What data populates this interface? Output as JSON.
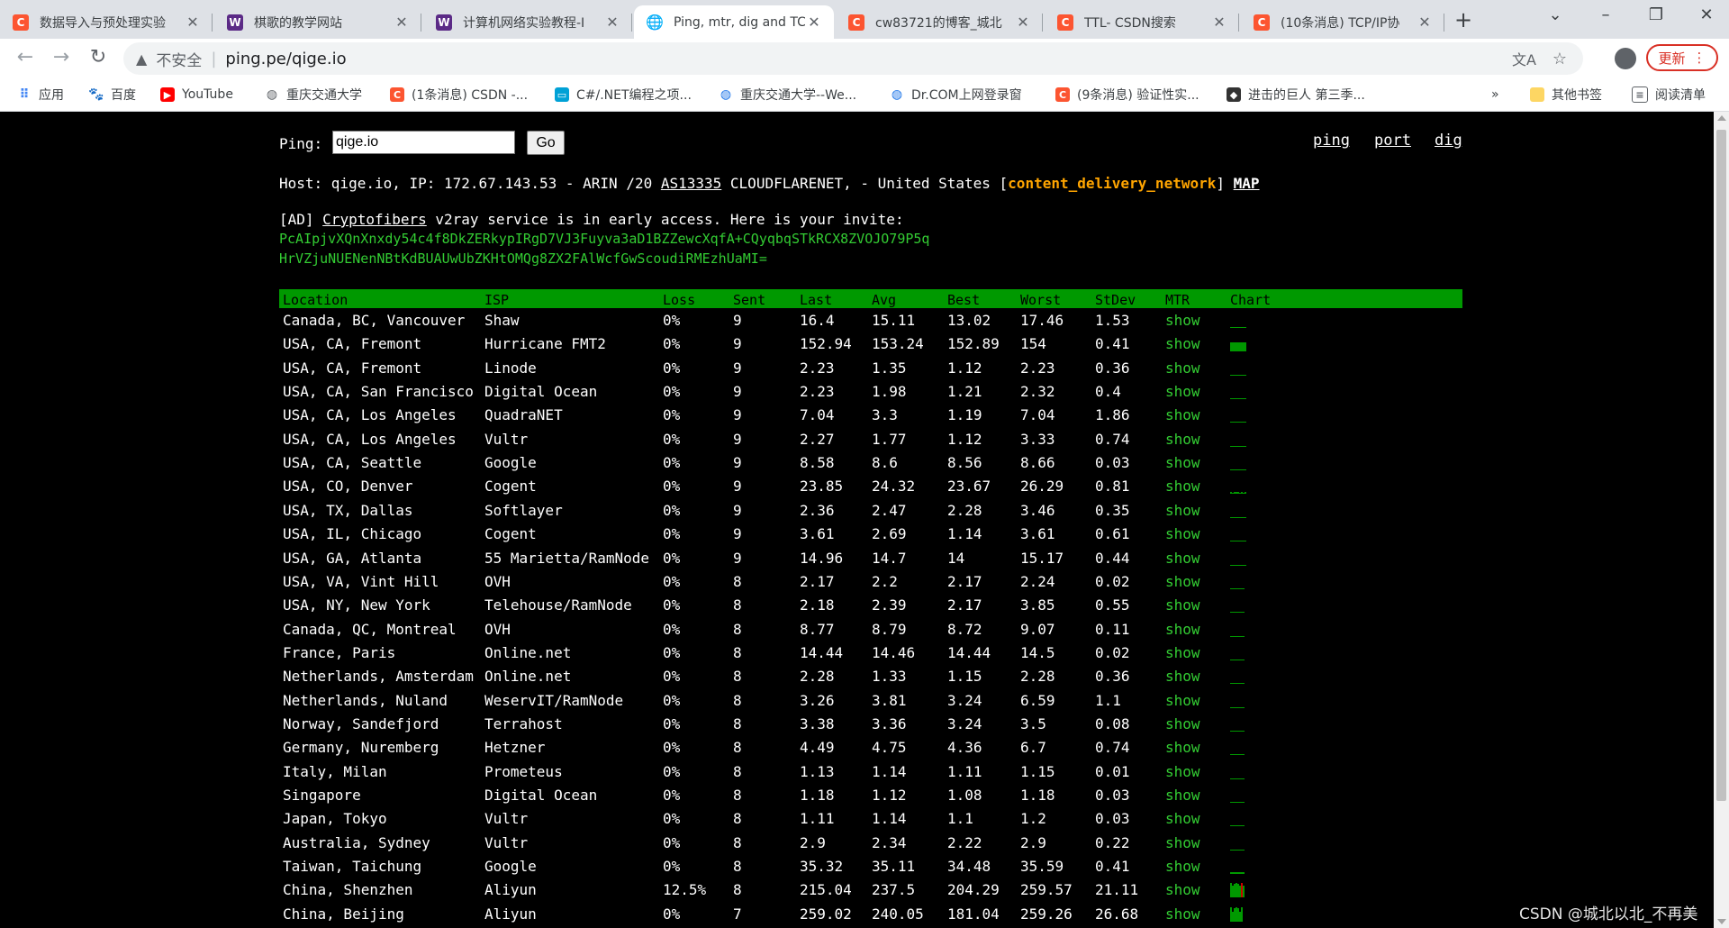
{
  "tabs": [
    {
      "title": "数据导入与预处理实验",
      "icon": "C",
      "color": "#fc5531"
    },
    {
      "title": "棋歌的教学网站",
      "icon": "W",
      "color": "#5b2a86"
    },
    {
      "title": "计算机网络实验教程-I",
      "icon": "W",
      "color": "#5b2a86"
    },
    {
      "title": "Ping, mtr, dig and TC",
      "icon": "globe",
      "color": "#5f6368",
      "active": true
    },
    {
      "title": "cw83721的博客_城北",
      "icon": "C",
      "color": "#fc5531"
    },
    {
      "title": "TTL- CSDN搜索",
      "icon": "C",
      "color": "#fc5531"
    },
    {
      "title": "(10条消息) TCP/IP协",
      "icon": "C",
      "color": "#fc5531"
    }
  ],
  "address_bar": {
    "insecure_label": "不安全",
    "url": "ping.pe/qige.io",
    "update_label": "更新"
  },
  "bookmarks": [
    {
      "label": "应用",
      "icon": "apps-icon",
      "color": "#4285f4"
    },
    {
      "label": "百度",
      "icon": "paw-icon",
      "color": "#2932e1"
    },
    {
      "label": "YouTube",
      "icon": "youtube-icon",
      "color": "#ff0000"
    },
    {
      "label": "重庆交通大学",
      "icon": "globe-icon",
      "color": "#5f6368"
    },
    {
      "label": "(1条消息) CSDN -...",
      "icon": "csdn-icon",
      "color": "#fc5531"
    },
    {
      "label": "C#/.NET编程之项...",
      "icon": "bilibili-icon",
      "color": "#00a1d6"
    },
    {
      "label": "重庆交通大学--We...",
      "icon": "globe-icon",
      "color": "#1a73e8"
    },
    {
      "label": "Dr.COM上网登录窗",
      "icon": "globe-icon",
      "color": "#1a73e8"
    },
    {
      "label": "(9条消息) 验证性实...",
      "icon": "csdn-icon",
      "color": "#fc5531"
    },
    {
      "label": "进击的巨人 第三季...",
      "icon": "anime-icon",
      "color": "#333333"
    }
  ],
  "bookmarks_right": {
    "more": "»",
    "other": "其他书签",
    "reading": "阅读清单"
  },
  "page": {
    "ping_label": "Ping:",
    "ping_value": "qige.io",
    "go_label": "Go",
    "links": [
      "ping",
      "port",
      "dig"
    ],
    "host_prefix": "Host: qige.io, IP: 172.67.143.53 - ARIN /20 ",
    "host_asn": "AS13335",
    "host_mid": " CLOUDFLARENET, - United States [",
    "host_tag": "content_delivery_network",
    "host_close": "] ",
    "host_map": "MAP",
    "ad_prefix": "[AD] ",
    "ad_link": "Cryptofibers",
    "ad_rest": " v2ray service is in early access. Here is your invite:",
    "invite_line1": "PcAIpjvXQnXnxdy54c4f8DkZERkypIRgD7VJ3Fuyva3aD1BZZewcXqfA+CQyqbqSTkRCX8ZVOJO79P5q",
    "invite_line2": "HrVZjuNUENenNBtKdBUAUwUbZKHtOMQg8ZX2FAlWcfGwScoudiRMEzhUaMI="
  },
  "table": {
    "headers": [
      "Location",
      "ISP",
      "Loss",
      "Sent",
      "Last",
      "Avg",
      "Best",
      "Worst",
      "StDev",
      "MTR",
      "Chart"
    ],
    "rows": [
      [
        "Canada, BC, Vancouver",
        "Shaw",
        "0%",
        "9",
        "16.4",
        "15.11",
        "13.02",
        "17.46",
        "1.53",
        "show"
      ],
      [
        "USA, CA, Fremont",
        "Hurricane FMT2",
        "0%",
        "9",
        "152.94",
        "153.24",
        "152.89",
        "154",
        "0.41",
        "show"
      ],
      [
        "USA, CA, Fremont",
        "Linode",
        "0%",
        "9",
        "2.23",
        "1.35",
        "1.12",
        "2.23",
        "0.36",
        "show"
      ],
      [
        "USA, CA, San Francisco",
        "Digital Ocean",
        "0%",
        "9",
        "2.23",
        "1.98",
        "1.21",
        "2.32",
        "0.4",
        "show"
      ],
      [
        "USA, CA, Los Angeles",
        "QuadraNET",
        "0%",
        "9",
        "7.04",
        "3.3",
        "1.19",
        "7.04",
        "1.86",
        "show"
      ],
      [
        "USA, CA, Los Angeles",
        "Vultr",
        "0%",
        "9",
        "2.27",
        "1.77",
        "1.12",
        "3.33",
        "0.74",
        "show"
      ],
      [
        "USA, CA, Seattle",
        "Google",
        "0%",
        "9",
        "8.58",
        "8.6",
        "8.56",
        "8.66",
        "0.03",
        "show"
      ],
      [
        "USA, CO, Denver",
        "Cogent",
        "0%",
        "9",
        "23.85",
        "24.32",
        "23.67",
        "26.29",
        "0.81",
        "show"
      ],
      [
        "USA, TX, Dallas",
        "Softlayer",
        "0%",
        "9",
        "2.36",
        "2.47",
        "2.28",
        "3.46",
        "0.35",
        "show"
      ],
      [
        "USA, IL, Chicago",
        "Cogent",
        "0%",
        "9",
        "3.61",
        "2.69",
        "1.14",
        "3.61",
        "0.61",
        "show"
      ],
      [
        "USA, GA, Atlanta",
        "55 Marietta/RamNode",
        "0%",
        "9",
        "14.96",
        "14.7",
        "14",
        "15.17",
        "0.44",
        "show"
      ],
      [
        "USA, VA, Vint Hill",
        "OVH",
        "0%",
        "8",
        "2.17",
        "2.2",
        "2.17",
        "2.24",
        "0.02",
        "show"
      ],
      [
        "USA, NY, New York",
        "Telehouse/RamNode",
        "0%",
        "8",
        "2.18",
        "2.39",
        "2.17",
        "3.85",
        "0.55",
        "show"
      ],
      [
        "Canada, QC, Montreal",
        "OVH",
        "0%",
        "8",
        "8.77",
        "8.79",
        "8.72",
        "9.07",
        "0.11",
        "show"
      ],
      [
        "France, Paris",
        "Online.net",
        "0%",
        "8",
        "14.44",
        "14.46",
        "14.44",
        "14.5",
        "0.02",
        "show"
      ],
      [
        "Netherlands, Amsterdam",
        "Online.net",
        "0%",
        "8",
        "2.28",
        "1.33",
        "1.15",
        "2.28",
        "0.36",
        "show"
      ],
      [
        "Netherlands, Nuland",
        "WeservIT/RamNode",
        "0%",
        "8",
        "3.26",
        "3.81",
        "3.24",
        "6.59",
        "1.1",
        "show"
      ],
      [
        "Norway, Sandefjord",
        "Terrahost",
        "0%",
        "8",
        "3.38",
        "3.36",
        "3.24",
        "3.5",
        "0.08",
        "show"
      ],
      [
        "Germany, Nuremberg",
        "Hetzner",
        "0%",
        "8",
        "4.49",
        "4.75",
        "4.36",
        "6.7",
        "0.74",
        "show"
      ],
      [
        "Italy, Milan",
        "Prometeus",
        "0%",
        "8",
        "1.13",
        "1.14",
        "1.11",
        "1.15",
        "0.01",
        "show"
      ],
      [
        "Singapore",
        "Digital Ocean",
        "0%",
        "8",
        "1.18",
        "1.12",
        "1.08",
        "1.18",
        "0.03",
        "show"
      ],
      [
        "Japan, Tokyo",
        "Vultr",
        "0%",
        "8",
        "1.11",
        "1.14",
        "1.1",
        "1.2",
        "0.03",
        "show"
      ],
      [
        "Australia, Sydney",
        "Vultr",
        "0%",
        "8",
        "2.9",
        "2.34",
        "2.22",
        "2.9",
        "0.22",
        "show"
      ],
      [
        "Taiwan, Taichung",
        "Google",
        "0%",
        "8",
        "35.32",
        "35.11",
        "34.48",
        "35.59",
        "0.41",
        "show"
      ],
      [
        "China, Shenzhen",
        "Aliyun",
        "12.5%",
        "8",
        "215.04",
        "237.5",
        "204.29",
        "259.57",
        "21.11",
        "show"
      ],
      [
        "China, Beijing",
        "Aliyun",
        "0%",
        "7",
        "259.02",
        "240.05",
        "181.04",
        "259.26",
        "26.68",
        "show"
      ]
    ]
  },
  "watermark": "CSDN @城北以北_不再美"
}
